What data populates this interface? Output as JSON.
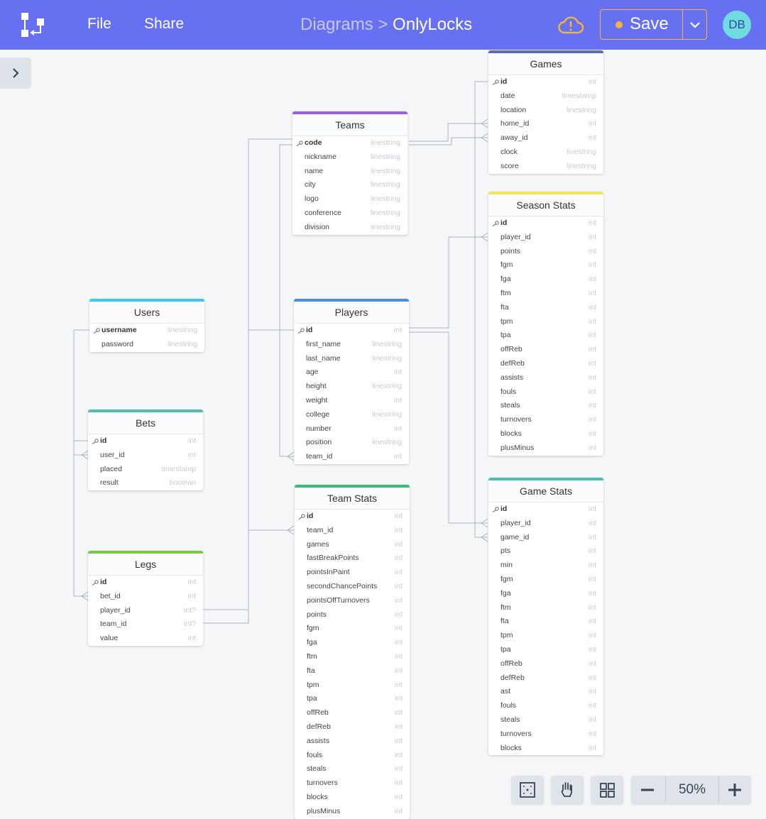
{
  "header": {
    "menu": [
      "File",
      "Share"
    ],
    "breadcrumb_parent": "Diagrams >",
    "breadcrumb_current": "OnlyLocks",
    "save_label": "Save",
    "avatar_initials": "DB"
  },
  "colors": {
    "topbar": "#6670f0",
    "save_accent": "#f5b53a"
  },
  "zoom": "50%",
  "tables": [
    {
      "name": "Games",
      "color": "#5c6bc0",
      "fields": [
        {
          "n": "id",
          "t": "int",
          "pk": true
        },
        {
          "n": "date",
          "t": "timestamp"
        },
        {
          "n": "location",
          "t": "linestring"
        },
        {
          "n": "home_id",
          "t": "int"
        },
        {
          "n": "away_id",
          "t": "int"
        },
        {
          "n": "clock",
          "t": "linestring"
        },
        {
          "n": "score",
          "t": "linestring"
        }
      ]
    },
    {
      "name": "Teams",
      "color": "#9c5ce6",
      "fields": [
        {
          "n": "code",
          "t": "linestring",
          "pk": true
        },
        {
          "n": "nickname",
          "t": "linestring"
        },
        {
          "n": "name",
          "t": "linestring"
        },
        {
          "n": "city",
          "t": "linestring"
        },
        {
          "n": "logo",
          "t": "linestring"
        },
        {
          "n": "conference",
          "t": "linestring"
        },
        {
          "n": "division",
          "t": "linestring"
        }
      ]
    },
    {
      "name": "Season Stats",
      "color": "#f7e45a",
      "fields": [
        {
          "n": "id",
          "t": "int",
          "pk": true
        },
        {
          "n": "player_id",
          "t": "int"
        },
        {
          "n": "points",
          "t": "int"
        },
        {
          "n": "fgm",
          "t": "int"
        },
        {
          "n": "fga",
          "t": "int"
        },
        {
          "n": "ftm",
          "t": "int"
        },
        {
          "n": "fta",
          "t": "int"
        },
        {
          "n": "tpm",
          "t": "int"
        },
        {
          "n": "tpa",
          "t": "int"
        },
        {
          "n": "offReb",
          "t": "int"
        },
        {
          "n": "defReb",
          "t": "int"
        },
        {
          "n": "assists",
          "t": "int"
        },
        {
          "n": "fouls",
          "t": "int"
        },
        {
          "n": "steals",
          "t": "int"
        },
        {
          "n": "turnovers",
          "t": "int"
        },
        {
          "n": "blocks",
          "t": "int"
        },
        {
          "n": "plusMinus",
          "t": "int"
        }
      ]
    },
    {
      "name": "Users",
      "color": "#3fc9e4",
      "fields": [
        {
          "n": "username",
          "t": "linestring",
          "pk": true
        },
        {
          "n": "password",
          "t": "linestring"
        }
      ]
    },
    {
      "name": "Players",
      "color": "#4a8fd8",
      "fields": [
        {
          "n": "id",
          "t": "int",
          "pk": true
        },
        {
          "n": "first_name",
          "t": "linestring"
        },
        {
          "n": "last_name",
          "t": "linestring"
        },
        {
          "n": "age",
          "t": "int"
        },
        {
          "n": "height",
          "t": "linestring"
        },
        {
          "n": "weight",
          "t": "int"
        },
        {
          "n": "college",
          "t": "linestring"
        },
        {
          "n": "number",
          "t": "int"
        },
        {
          "n": "position",
          "t": "linestring"
        },
        {
          "n": "team_id",
          "t": "int"
        }
      ]
    },
    {
      "name": "Bets",
      "color": "#4fbfb5",
      "fields": [
        {
          "n": "id",
          "t": "int",
          "pk": true
        },
        {
          "n": "user_id",
          "t": "int"
        },
        {
          "n": "placed",
          "t": "timestamp"
        },
        {
          "n": "result",
          "t": "boolean"
        }
      ]
    },
    {
      "name": "Game Stats",
      "color": "#4fbfb5",
      "fields": [
        {
          "n": "id",
          "t": "int",
          "pk": true
        },
        {
          "n": "player_id",
          "t": "int"
        },
        {
          "n": "game_id",
          "t": "int"
        },
        {
          "n": "pts",
          "t": "int"
        },
        {
          "n": "min",
          "t": "int"
        },
        {
          "n": "fgm",
          "t": "int"
        },
        {
          "n": "fga",
          "t": "int"
        },
        {
          "n": "ftm",
          "t": "int"
        },
        {
          "n": "fta",
          "t": "int"
        },
        {
          "n": "tpm",
          "t": "int"
        },
        {
          "n": "tpa",
          "t": "int"
        },
        {
          "n": "offReb",
          "t": "int"
        },
        {
          "n": "defReb",
          "t": "int"
        },
        {
          "n": "ast",
          "t": "int"
        },
        {
          "n": "fouls",
          "t": "int"
        },
        {
          "n": "steals",
          "t": "int"
        },
        {
          "n": "turnovers",
          "t": "int"
        },
        {
          "n": "blocks",
          "t": "int"
        }
      ]
    },
    {
      "name": "Team Stats",
      "color": "#3dbb7a",
      "fields": [
        {
          "n": "id",
          "t": "int",
          "pk": true
        },
        {
          "n": "team_id",
          "t": "int"
        },
        {
          "n": "games",
          "t": "int"
        },
        {
          "n": "fastBreakPoints",
          "t": "int"
        },
        {
          "n": "pointsInPaint",
          "t": "int"
        },
        {
          "n": "secondChancePoints",
          "t": "int"
        },
        {
          "n": "pointsOffTurnovers",
          "t": "int"
        },
        {
          "n": "points",
          "t": "int"
        },
        {
          "n": "fgm",
          "t": "int"
        },
        {
          "n": "fga",
          "t": "int"
        },
        {
          "n": "ftm",
          "t": "int"
        },
        {
          "n": "fta",
          "t": "int"
        },
        {
          "n": "tpm",
          "t": "int"
        },
        {
          "n": "tpa",
          "t": "int"
        },
        {
          "n": "offReb",
          "t": "int"
        },
        {
          "n": "defReb",
          "t": "int"
        },
        {
          "n": "assists",
          "t": "int"
        },
        {
          "n": "fouls",
          "t": "int"
        },
        {
          "n": "steals",
          "t": "int"
        },
        {
          "n": "turnovers",
          "t": "int"
        },
        {
          "n": "blocks",
          "t": "int"
        },
        {
          "n": "plusMinus",
          "t": "int"
        }
      ]
    },
    {
      "name": "Legs",
      "color": "#7ac943",
      "fields": [
        {
          "n": "id",
          "t": "int",
          "pk": true
        },
        {
          "n": "bet_id",
          "t": "int"
        },
        {
          "n": "player_id",
          "t": "int?"
        },
        {
          "n": "team_id",
          "t": "int?"
        },
        {
          "n": "value",
          "t": "int"
        }
      ]
    }
  ]
}
